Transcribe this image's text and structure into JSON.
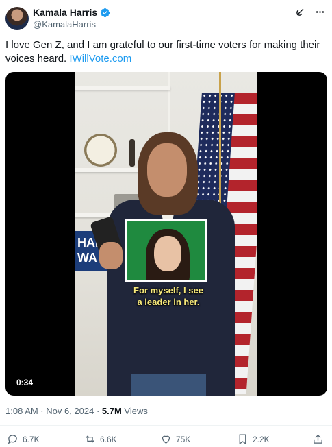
{
  "author": {
    "name": "Kamala Harris",
    "handle": "@KamalaHarris",
    "verified_color": "#1d9bf0"
  },
  "header_icons": [
    "grok-icon",
    "more-icon"
  ],
  "tweet": {
    "text": "I love Gen Z, and I am grateful to our first-time voters for making their voices heard.",
    "link": "IWillVote.com",
    "link_color": "#1d9bf0"
  },
  "video": {
    "caption_line1": "For myself, I see",
    "caption_line2": "a leader in her.",
    "duration": "0:34",
    "sign_text": "HAR\nWA"
  },
  "meta": {
    "time": "1:08 AM · Nov 6, 2024 · ",
    "views_count": "5.7M",
    "views_label": " Views"
  },
  "actions": {
    "reply_count": "6.7K",
    "repost_count": "6.6K",
    "like_count": "75K",
    "bookmark_count": "2.2K"
  }
}
